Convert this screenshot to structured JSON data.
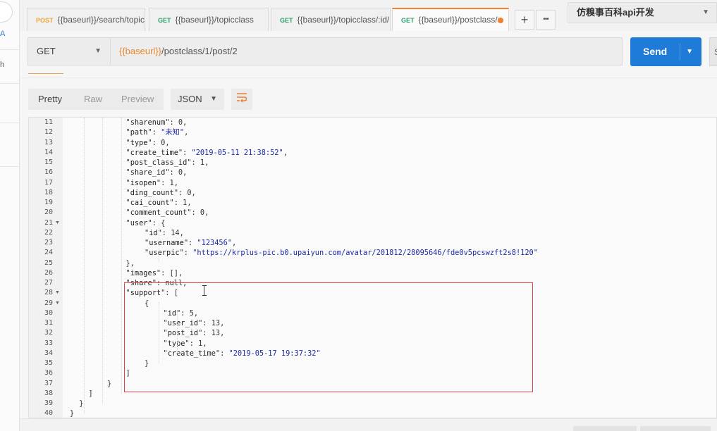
{
  "sidebar": {
    "label_a": "A",
    "label_h": "h"
  },
  "tabs": [
    {
      "method": "POST",
      "url": "{{baseurl}}/search/topic"
    },
    {
      "method": "GET",
      "url": "{{baseurl}}/topicclass"
    },
    {
      "method": "GET",
      "url": "{{baseurl}}/topicclass/:id/"
    },
    {
      "method": "GET",
      "url": "{{baseurl}}/postclass/:",
      "active": true,
      "unsaved": true
    }
  ],
  "tab_actions": {
    "add": "+",
    "more": "•••"
  },
  "environment": {
    "selected": "仿糗事百科api开发"
  },
  "request": {
    "method": "GET",
    "url_var": "{{baseurl}}",
    "url_path": "/postclass/1/post/2",
    "send_label": "Send",
    "save_stub": "S"
  },
  "response_toolbar": {
    "view_tabs": [
      "Pretty",
      "Raw",
      "Preview"
    ],
    "active_view": "Pretty",
    "format": "JSON"
  },
  "code_lines": [
    {
      "n": 11,
      "i": 3,
      "k": "sharenum",
      "v": "0",
      "t": "num",
      "c": true
    },
    {
      "n": 12,
      "i": 3,
      "k": "path",
      "v": "\"未知\"",
      "t": "str",
      "c": true
    },
    {
      "n": 13,
      "i": 3,
      "k": "type",
      "v": "0",
      "t": "num",
      "c": true
    },
    {
      "n": 14,
      "i": 3,
      "k": "create_time",
      "v": "\"2019-05-11 21:38:52\"",
      "t": "str",
      "c": true
    },
    {
      "n": 15,
      "i": 3,
      "k": "post_class_id",
      "v": "1",
      "t": "num",
      "c": true
    },
    {
      "n": 16,
      "i": 3,
      "k": "share_id",
      "v": "0",
      "t": "num",
      "c": true
    },
    {
      "n": 17,
      "i": 3,
      "k": "isopen",
      "v": "1",
      "t": "num",
      "c": true
    },
    {
      "n": 18,
      "i": 3,
      "k": "ding_count",
      "v": "0",
      "t": "num",
      "c": true
    },
    {
      "n": 19,
      "i": 3,
      "k": "cai_count",
      "v": "1",
      "t": "num",
      "c": true
    },
    {
      "n": 20,
      "i": 3,
      "k": "comment_count",
      "v": "0",
      "t": "num",
      "c": true
    },
    {
      "n": 21,
      "i": 3,
      "k": "user",
      "v": "{",
      "t": "p",
      "c": false,
      "fold": true
    },
    {
      "n": 22,
      "i": 4,
      "k": "id",
      "v": "14",
      "t": "num",
      "c": true
    },
    {
      "n": 23,
      "i": 4,
      "k": "username",
      "v": "\"123456\"",
      "t": "str",
      "c": true
    },
    {
      "n": 24,
      "i": 4,
      "k": "userpic",
      "v": "\"https://krplus-pic.b0.upaiyun.com/avatar/201812/28095646/fde0v5pcswzft2s8!120\"",
      "t": "str",
      "c": false
    },
    {
      "n": 25,
      "i": 3,
      "raw": "},"
    },
    {
      "n": 26,
      "i": 3,
      "k": "images",
      "v": "[]",
      "t": "p",
      "c": true
    },
    {
      "n": 27,
      "i": 3,
      "k": "share",
      "v": "null",
      "t": "num",
      "c": true
    },
    {
      "n": 28,
      "i": 3,
      "k": "support",
      "v": "[",
      "t": "p",
      "c": false,
      "fold": true
    },
    {
      "n": 29,
      "i": 4,
      "raw": "{",
      "fold": true
    },
    {
      "n": 30,
      "i": 5,
      "k": "id",
      "v": "5",
      "t": "num",
      "c": true
    },
    {
      "n": 31,
      "i": 5,
      "k": "user_id",
      "v": "13",
      "t": "num",
      "c": true
    },
    {
      "n": 32,
      "i": 5,
      "k": "post_id",
      "v": "13",
      "t": "num",
      "c": true
    },
    {
      "n": 33,
      "i": 5,
      "k": "type",
      "v": "1",
      "t": "num",
      "c": true
    },
    {
      "n": 34,
      "i": 5,
      "k": "create_time",
      "v": "\"2019-05-17 19:37:32\"",
      "t": "str",
      "c": false
    },
    {
      "n": 35,
      "i": 4,
      "raw": "}"
    },
    {
      "n": 36,
      "i": 3,
      "raw": "]"
    },
    {
      "n": 37,
      "i": 2,
      "raw": "}"
    },
    {
      "n": 38,
      "i": 1,
      "raw": "]"
    },
    {
      "n": 39,
      "i": 0.5,
      "raw": "}"
    },
    {
      "n": 40,
      "i": 0,
      "raw": "}"
    }
  ],
  "colors": {
    "accent_orange": "#f0812f",
    "send_blue": "#1e7bd8",
    "string_blue": "#1a2aa6",
    "highlight_red": "#d44444"
  }
}
